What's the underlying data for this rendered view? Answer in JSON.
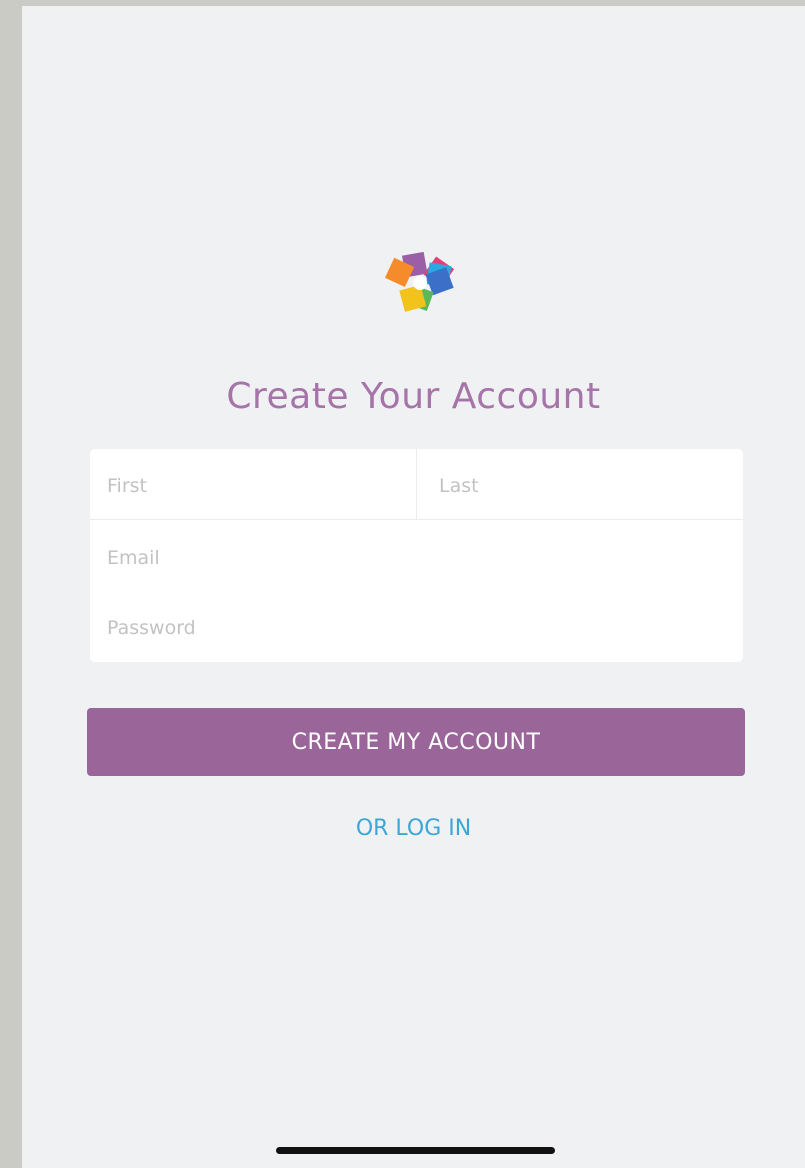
{
  "logo": {
    "icon": "multicolor-star-logo",
    "colors": [
      "#e63e7a",
      "#2aa9e0",
      "#3b6fc8",
      "#5bb85a",
      "#f2c31b",
      "#f58b2a",
      "#9b5fa8"
    ]
  },
  "page": {
    "title": "Create Your Account"
  },
  "form": {
    "first_placeholder": "First",
    "last_placeholder": "Last",
    "email_placeholder": "Email",
    "password_placeholder": "Password"
  },
  "actions": {
    "create_label": "CREATE MY ACCOUNT",
    "login_label": "OR LOG IN"
  },
  "colors": {
    "accent": "#9a6699",
    "title": "#a674a8",
    "link": "#3ba7d6",
    "background": "#f0f1f3"
  }
}
